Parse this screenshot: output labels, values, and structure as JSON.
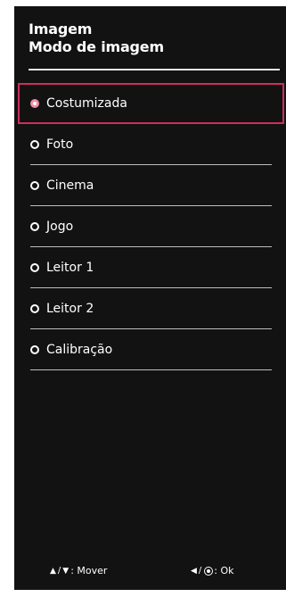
{
  "header": {
    "title": "Imagem",
    "subtitle": "Modo de imagem"
  },
  "menu": {
    "items": [
      {
        "label": "Costumizada",
        "selected": true
      },
      {
        "label": "Foto",
        "selected": false
      },
      {
        "label": "Cinema",
        "selected": false
      },
      {
        "label": "Jogo",
        "selected": false
      },
      {
        "label": "Leitor 1",
        "selected": false
      },
      {
        "label": "Leitor 2",
        "selected": false
      },
      {
        "label": "Calibração",
        "selected": false
      }
    ]
  },
  "footer": {
    "move_label": ": Mover",
    "ok_label": ": Ok",
    "move_icons": [
      "up-arrow-icon",
      "down-arrow-icon"
    ],
    "ok_icons": [
      "left-arrow-icon",
      "ok-button-icon"
    ]
  },
  "colors": {
    "panel_background": "#121212",
    "selection_border": "#cf2d5c",
    "text": "#ffffff"
  }
}
